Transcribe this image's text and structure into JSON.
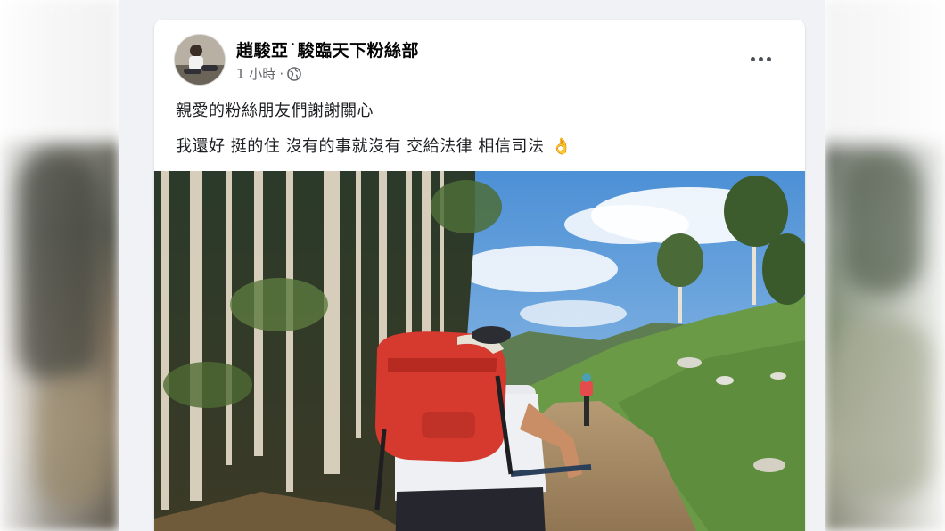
{
  "post": {
    "author_name": "趙駿亞˙駿臨天下粉絲部",
    "timestamp": "1 小時",
    "separator": "·",
    "privacy_icon": "globe-icon",
    "more_icon": "more-options-icon",
    "text_lines": [
      "親愛的粉絲朋友們謝謝關心",
      "我還好 挺的住 沒有的事就沒有 交給法律 相信司法"
    ],
    "emoji": "👌",
    "photo_alt": "mountain-biking-photo"
  },
  "colors": {
    "feed_bg": "#f0f2f5",
    "card_bg": "#ffffff",
    "name_color": "#050505",
    "meta_color": "#65676b"
  }
}
